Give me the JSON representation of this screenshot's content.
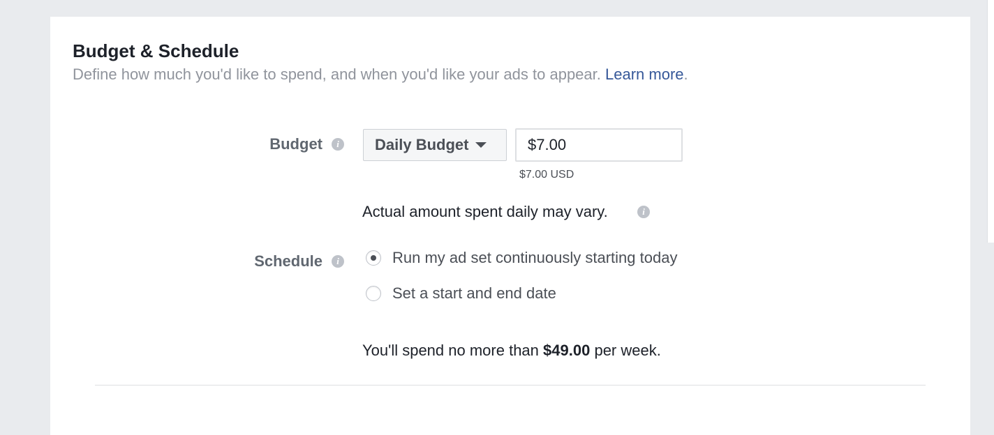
{
  "section": {
    "title": "Budget & Schedule",
    "description": "Define how much you'd like to spend, and when you'd like your ads to appear.",
    "learn_more": "Learn more",
    "period": "."
  },
  "budget": {
    "label": "Budget",
    "type_selected": "Daily Budget",
    "amount_value": "$7.00",
    "currency_hint": "$7.00 USD",
    "variance_note": "Actual amount spent daily may vary."
  },
  "schedule": {
    "label": "Schedule",
    "options": [
      {
        "label": "Run my ad set continuously starting today",
        "selected": true
      },
      {
        "label": "Set a start and end date",
        "selected": false
      }
    ]
  },
  "summary": {
    "prefix": "You'll spend no more than",
    "amount": "$49.00",
    "suffix": "per week."
  },
  "icons": {
    "info": "info-icon",
    "caret": "chevron-down-icon"
  },
  "colors": {
    "link": "#365899",
    "page_background": "#e9ebee"
  }
}
